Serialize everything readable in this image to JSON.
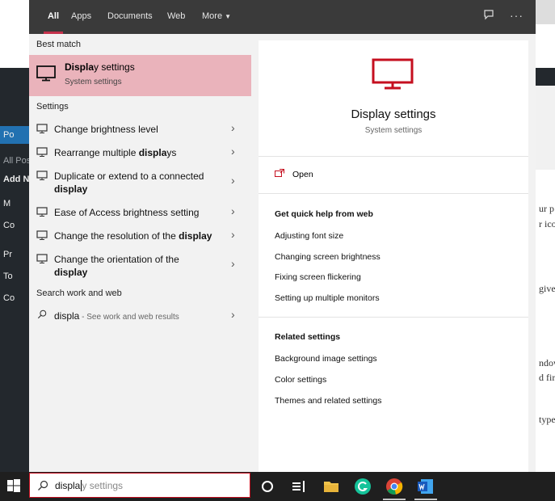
{
  "background": {
    "left_nav": [
      "Po",
      "All Pos",
      "Add N",
      "M",
      "Co",
      "Pr",
      "To",
      "Co"
    ],
    "right_fragments": [
      "ur p",
      "r icor",
      "give",
      "ndow",
      "d firs",
      "type"
    ]
  },
  "tabs": [
    "All",
    "Apps",
    "Documents",
    "Web",
    "More"
  ],
  "sections": {
    "best_match": "Best match",
    "settings": "Settings",
    "search_web": "Search work and web"
  },
  "best_match": {
    "title": "Display settings",
    "title_bold": "Displa",
    "title_rest": "y settings",
    "subtitle": "System settings"
  },
  "settings_items": [
    {
      "label": "Change brightness level"
    },
    {
      "label": "Rearrange multiple displays",
      "plain": "Rearrange multiple ",
      "bold": "displa",
      "rest": "ys"
    },
    {
      "label": "Duplicate or extend to a connected display",
      "plain": "Duplicate or extend to a connected ",
      "bold": "display",
      "rest": ""
    },
    {
      "label": "Ease of Access brightness setting"
    },
    {
      "label": "Change the resolution of the display",
      "plain": "Change the resolution of the ",
      "bold": "display",
      "rest": ""
    },
    {
      "label": "Change the orientation of the display",
      "plain": "Change the orientation of the ",
      "bold": "display",
      "rest": ""
    }
  ],
  "web_result": {
    "query": "displa",
    "hint": "See work and web results"
  },
  "detail": {
    "title": "Display settings",
    "subtitle": "System settings",
    "open_label": "Open",
    "quick_help_heading": "Get quick help from web",
    "quick_help": [
      "Adjusting font size",
      "Changing screen brightness",
      "Fixing screen flickering",
      "Setting up multiple monitors"
    ],
    "related_heading": "Related settings",
    "related": [
      "Background image settings",
      "Color settings",
      "Themes and related settings"
    ]
  },
  "searchbox": {
    "typed": "displa",
    "suggest": "y settings"
  },
  "colors": {
    "accent": "#c50f1f",
    "highlight": "#eab3bb",
    "topbar": "#3a3a3a",
    "taskbar": "#1f1f1f"
  }
}
